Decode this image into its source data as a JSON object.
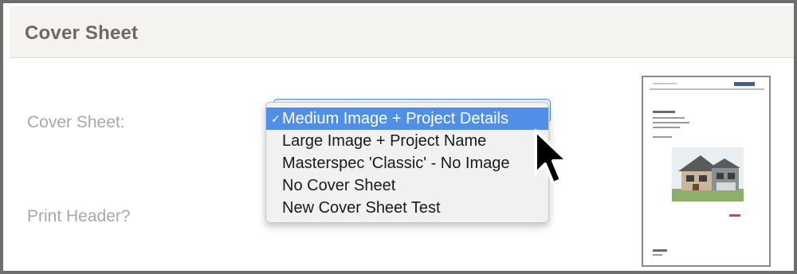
{
  "panel": {
    "title": "Cover Sheet"
  },
  "form": {
    "cover_sheet_label": "Cover Sheet:",
    "print_header_label": "Print Header?"
  },
  "dropdown": {
    "selected": "Medium Image + Project Details",
    "check_mark": "✓",
    "options": [
      "Medium Image + Project Details",
      "Large Image + Project Name",
      "Masterspec 'Classic' - No Image",
      "No Cover Sheet",
      "New Cover Sheet Test"
    ]
  },
  "thumbnail": {
    "icon": "cover-sheet-preview"
  },
  "colors": {
    "selection": "#4f8fe8",
    "label_gray": "#a8a8a8",
    "header_bg": "#f4f3ef",
    "title_color": "#6f6765"
  }
}
